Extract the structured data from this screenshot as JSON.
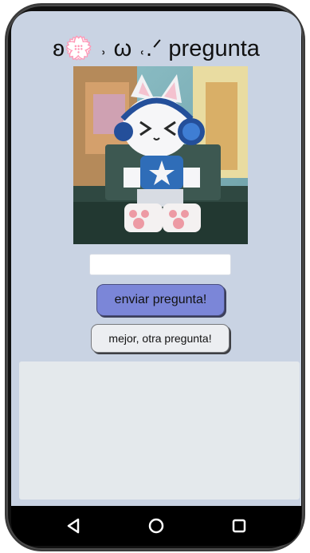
{
  "app": {
    "title_text": "ʚ💮 ˒ ω ˓.ᐟ pregunta",
    "hero_image": "anime-cat-with-headphones-on-train"
  },
  "form": {
    "input_value": "",
    "input_placeholder": "",
    "send_label": "enviar pregunta!",
    "other_label": "mejor, otra pregunta!"
  },
  "answer": {
    "text": ""
  },
  "navigation": {
    "back_icon": "triangle-back-icon",
    "home_icon": "circle-home-icon",
    "recents_icon": "square-recents-icon"
  },
  "colors": {
    "screen_bg": "#c9d3e3",
    "primary_button": "#7b86d8",
    "secondary_button": "#eceef1",
    "answer_panel": "#e4e9ec",
    "navbar": "#000000"
  }
}
